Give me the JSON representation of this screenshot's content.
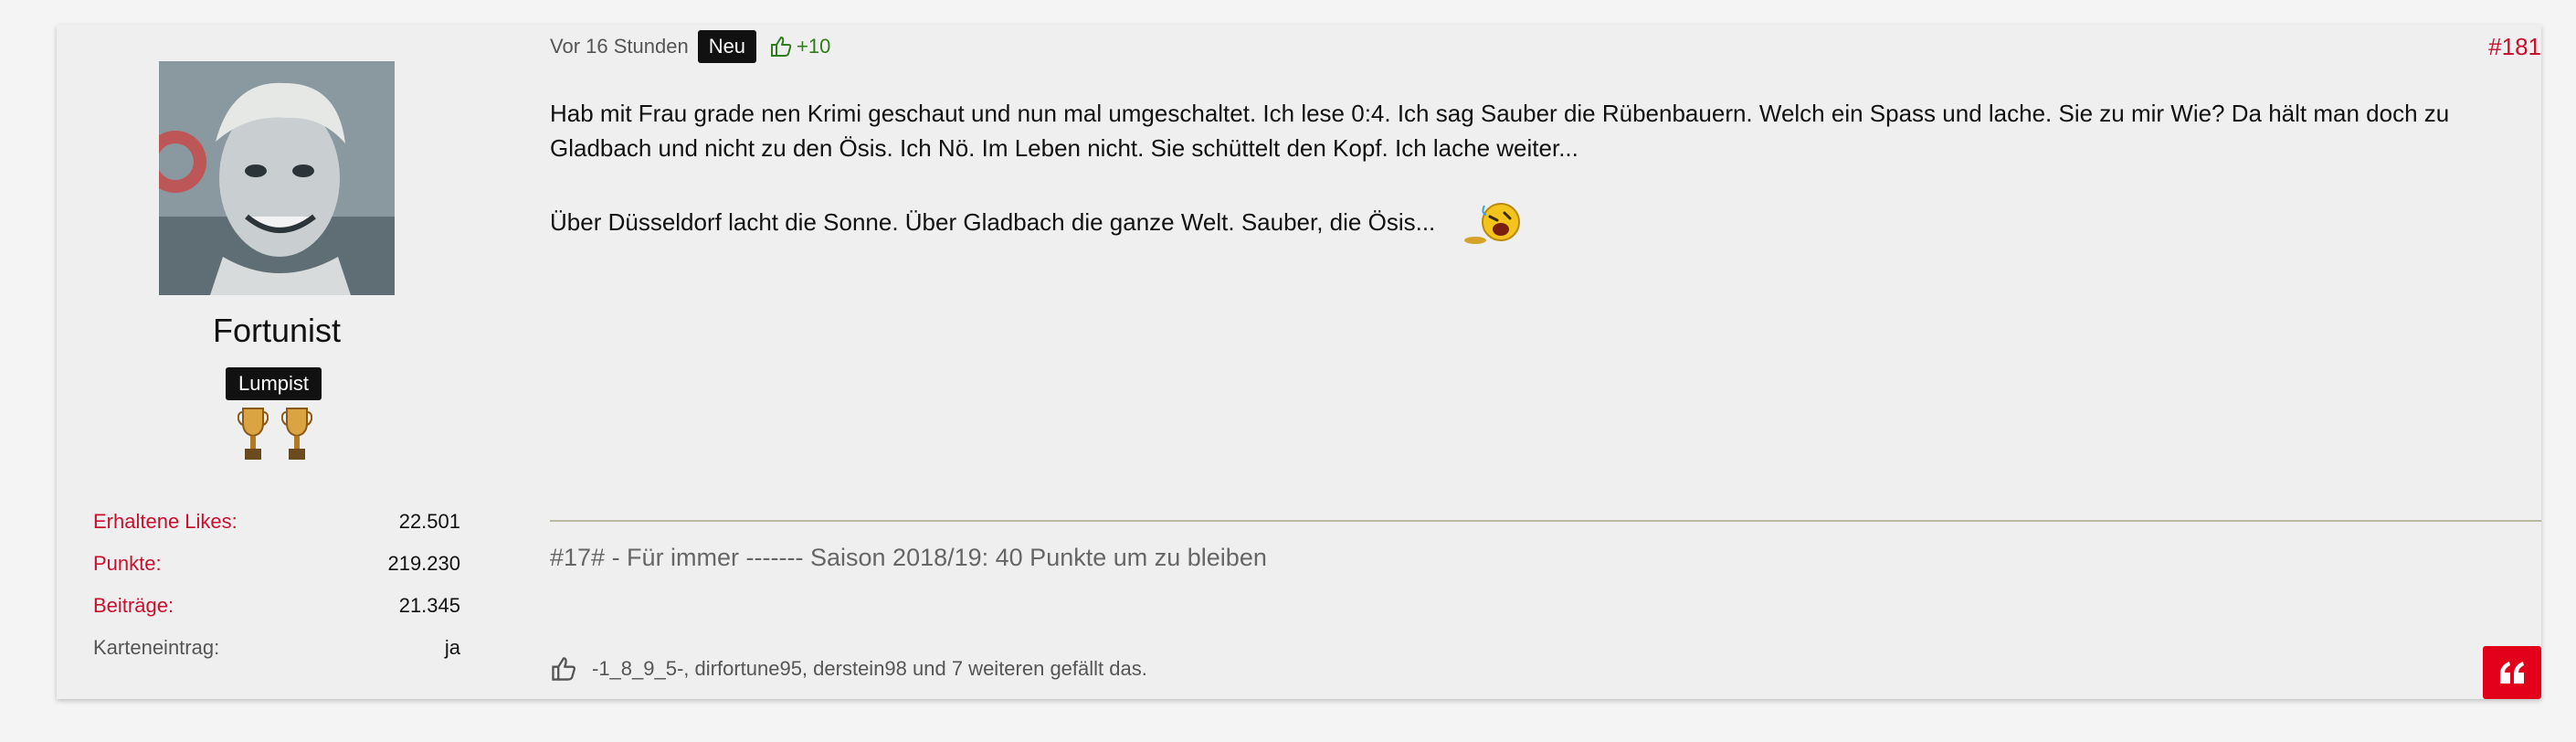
{
  "user": {
    "name": "Fortunist",
    "rank": "Lumpist",
    "stats": [
      {
        "label": "Erhaltene Likes:",
        "value": "22.501"
      },
      {
        "label": "Punkte:",
        "value": "219.230"
      },
      {
        "label": "Beiträge:",
        "value": "21.345"
      },
      {
        "label": "Karteneintrag:",
        "value": "ja"
      }
    ],
    "trophy_count": 2
  },
  "post": {
    "time": "Vor 16 Stunden",
    "badge": "Neu",
    "likes": "+10",
    "number": "#181",
    "body": [
      "Hab mit Frau grade nen Krimi geschaut und nun mal umgeschaltet. Ich lese 0:4. Ich sag Sauber die Rübenbauern. Welch ein Spass und lache. Sie zu mir Wie? Da hält man doch zu",
      "Gladbach und nicht zu den Ösis. Ich Nö. Im Leben nicht. Sie schüttelt den Kopf. Ich lache weiter...",
      "Über Düsseldorf lacht die Sonne. Über Gladbach die ganze Welt. Sauber, die Ösis..."
    ],
    "signature": "#17# - Für immer ------- Saison 2018/19: 40 Punkte um zu bleiben",
    "like_summary": "-1_8_9_5-, dirfortune95, derstein98 und 7 weiteren gefällt das."
  },
  "colors": {
    "accent": "#c8102e",
    "quote_button": "#e3001b",
    "like_green": "#2f7d1a"
  },
  "icons": [
    "thumbs-up-icon",
    "quote-icon",
    "trophy-icon",
    "laughing-emoji-icon"
  ]
}
